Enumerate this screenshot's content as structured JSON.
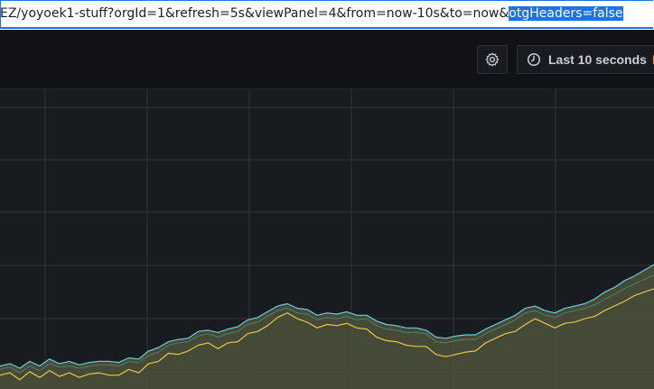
{
  "browser": {
    "url_prefix": "EZ/yoyoek1-stuff?orgId=1&refresh=5s&viewPanel=4&from=now-10s&to=now&",
    "url_selected": "otgHeaders=false"
  },
  "toolbar": {
    "settings_icon": "gear-icon",
    "time_icon": "clock-icon",
    "time_range_label": "Last 10 seconds",
    "time_range_suffix": "E"
  },
  "colors": {
    "series_a": "#6ccadc",
    "series_b": "#e5c44a",
    "fill": "#4a5038",
    "panel_bg": "#181b1f",
    "grid": "#33363d"
  },
  "chart_data": {
    "type": "area",
    "grid": true,
    "series": [
      {
        "values": [
          20,
          22,
          18,
          24,
          20,
          26,
          22,
          24,
          21,
          23,
          24,
          24,
          23,
          27,
          26,
          33,
          36,
          41,
          43,
          44,
          50,
          51,
          49,
          52,
          54,
          60,
          62,
          67,
          72,
          74,
          70,
          69,
          64,
          66,
          65,
          67,
          64,
          64,
          59,
          56,
          55,
          53,
          53,
          51,
          45,
          44,
          46,
          47,
          47,
          52,
          56,
          60,
          64,
          70,
          72,
          68,
          66,
          70,
          72,
          74,
          78,
          84,
          88,
          94,
          98,
          103,
          108
        ]
      },
      {
        "values": [
          17,
          19,
          14,
          20,
          16,
          22,
          19,
          20,
          18,
          20,
          21,
          21,
          20,
          24,
          23,
          29,
          32,
          38,
          40,
          41,
          46,
          48,
          45,
          48,
          50,
          56,
          58,
          63,
          68,
          70,
          66,
          65,
          60,
          62,
          61,
          63,
          60,
          61,
          55,
          52,
          51,
          49,
          49,
          48,
          41,
          40,
          42,
          43,
          43,
          48,
          52,
          56,
          60,
          66,
          68,
          64,
          62,
          66,
          68,
          70,
          73,
          78,
          82,
          87,
          91,
          95,
          99
        ]
      },
      {
        "values": [
          12,
          14,
          8,
          15,
          10,
          16,
          11,
          14,
          10,
          13,
          14,
          12,
          12,
          17,
          14,
          22,
          24,
          31,
          30,
          33,
          38,
          40,
          35,
          40,
          41,
          48,
          50,
          55,
          62,
          66,
          61,
          58,
          53,
          56,
          55,
          57,
          53,
          52,
          45,
          42,
          41,
          38,
          37,
          37,
          30,
          28,
          30,
          32,
          33,
          40,
          44,
          48,
          50,
          56,
          61,
          57,
          53,
          57,
          58,
          61,
          63,
          68,
          72,
          76,
          81,
          84,
          87
        ]
      }
    ]
  }
}
